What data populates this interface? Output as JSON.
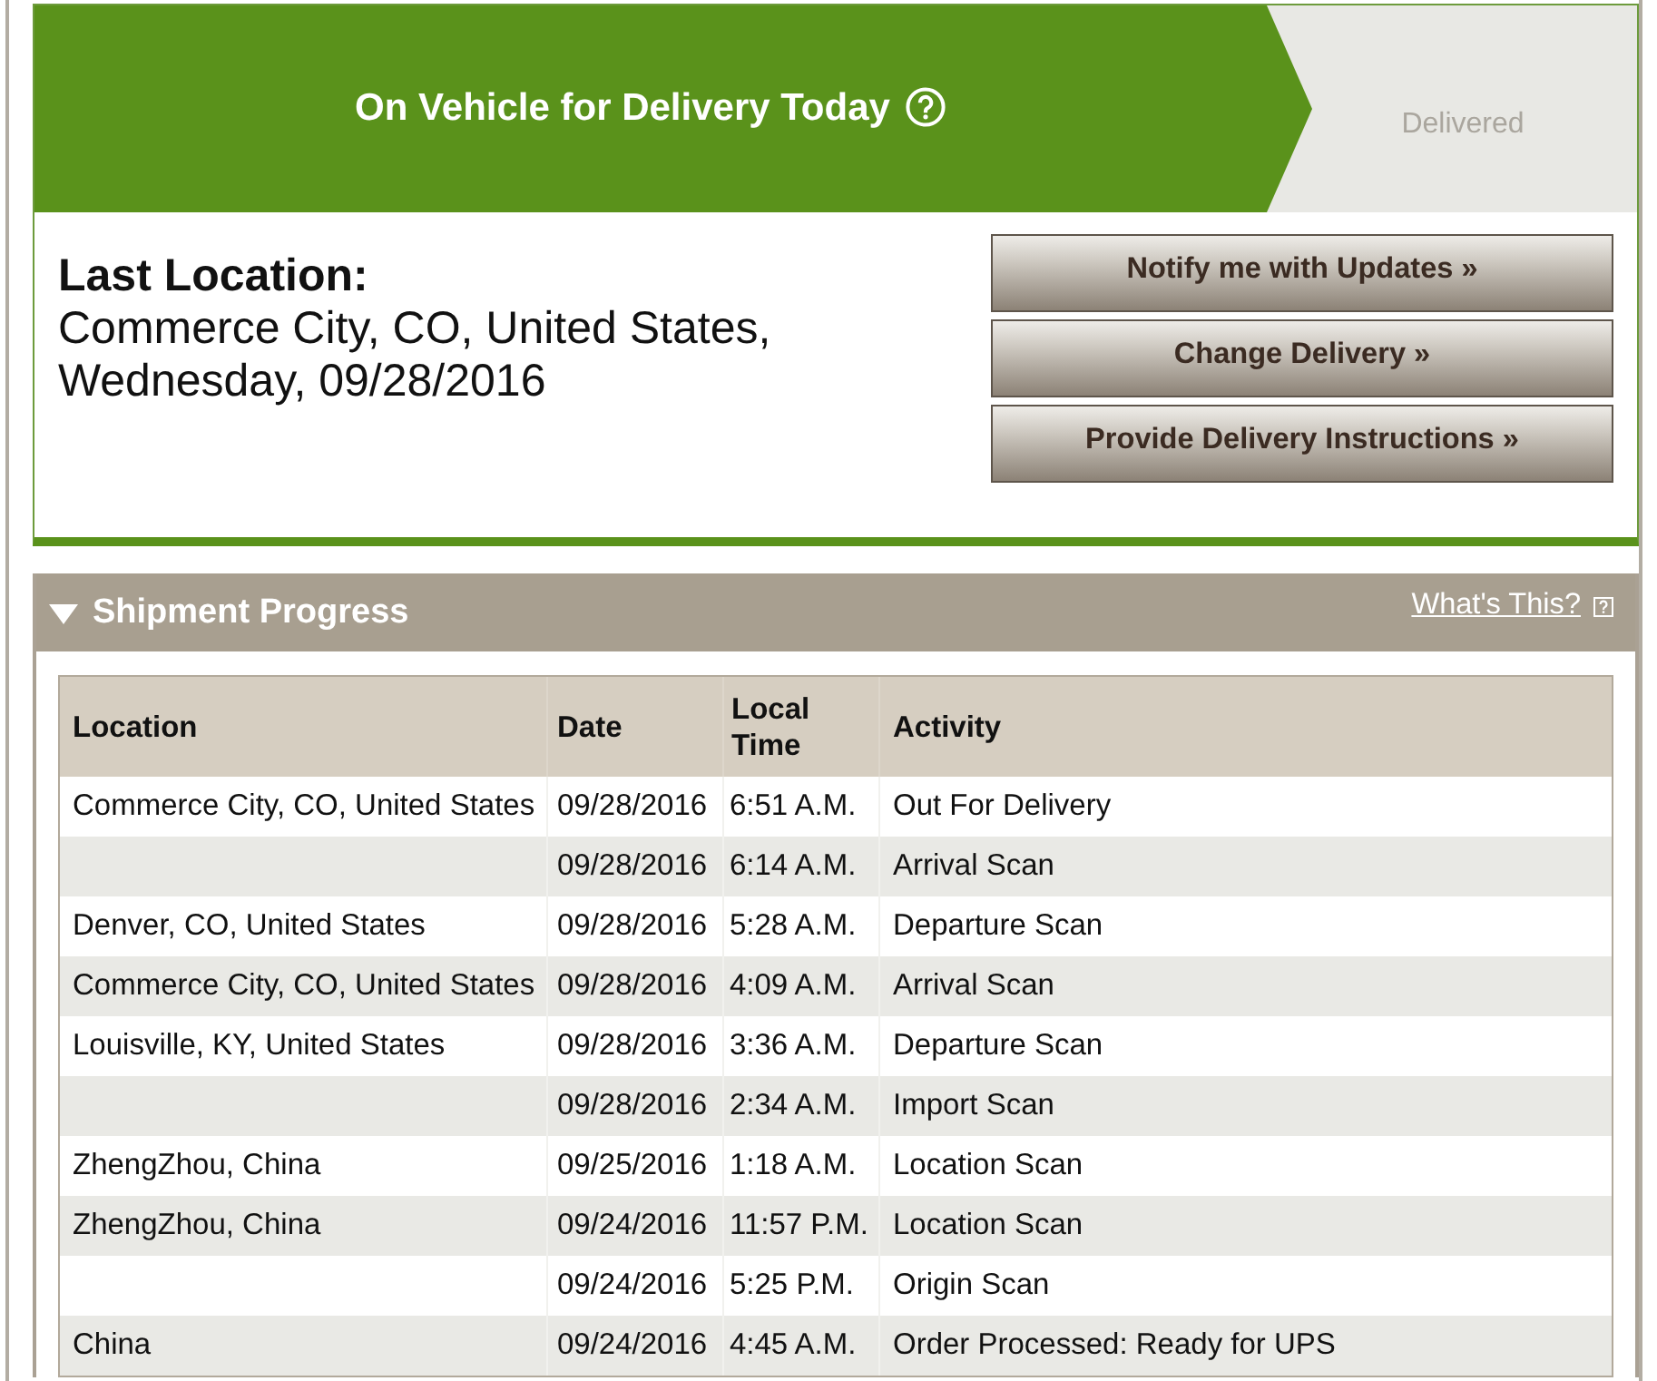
{
  "status_banner": {
    "stages": [
      {
        "label": "On Vehicle for Delivery Today",
        "selected": true,
        "help": true
      },
      {
        "label": "Delivered",
        "selected": false,
        "help": false
      }
    ]
  },
  "last_location": {
    "label": "Last Location:",
    "text": "Commerce City, CO, United States, Wednesday, 09/28/2016"
  },
  "actions": [
    "Notify me with Updates »",
    "Change Delivery »",
    "Provide Delivery Instructions »"
  ],
  "shipment_progress": {
    "title": "Shipment Progress",
    "expanded": true,
    "help_link": "What's This?",
    "table": {
      "columns": [
        "Location",
        "Date",
        "Local Time",
        "Activity"
      ],
      "rows": [
        {
          "location": "Commerce City, CO, United States",
          "date": "09/28/2016",
          "time": "6:51 A.M.",
          "activity": "Out For Delivery"
        },
        {
          "date": "09/28/2016",
          "time": "6:14 A.M.",
          "activity": "Arrival Scan"
        },
        {
          "location": "Denver, CO, United States",
          "date": "09/28/2016",
          "time": "5:28 A.M.",
          "activity": "Departure Scan"
        },
        {
          "location": "Commerce City, CO, United States",
          "date": "09/28/2016",
          "time": "4:09 A.M.",
          "activity": "Arrival Scan"
        },
        {
          "location": "Louisville, KY, United States",
          "date": "09/28/2016",
          "time": "3:36 A.M.",
          "activity": "Departure Scan"
        },
        {
          "date": "09/28/2016",
          "time": "2:34 A.M.",
          "activity": "Import Scan"
        },
        {
          "location": "ZhengZhou, China",
          "date": "09/25/2016",
          "time": "1:18 A.M.",
          "activity": "Location Scan"
        },
        {
          "location": "ZhengZhou, China",
          "date": "09/24/2016",
          "time": "11:57 P.M.",
          "activity": "Location Scan"
        },
        {
          "date": "09/24/2016",
          "time": "5:25 P.M.",
          "activity": "Origin Scan"
        },
        {
          "location": "China",
          "date": "09/24/2016",
          "time": "4:45 A.M.",
          "activity": "Order Processed: Ready for UPS"
        }
      ]
    }
  }
}
